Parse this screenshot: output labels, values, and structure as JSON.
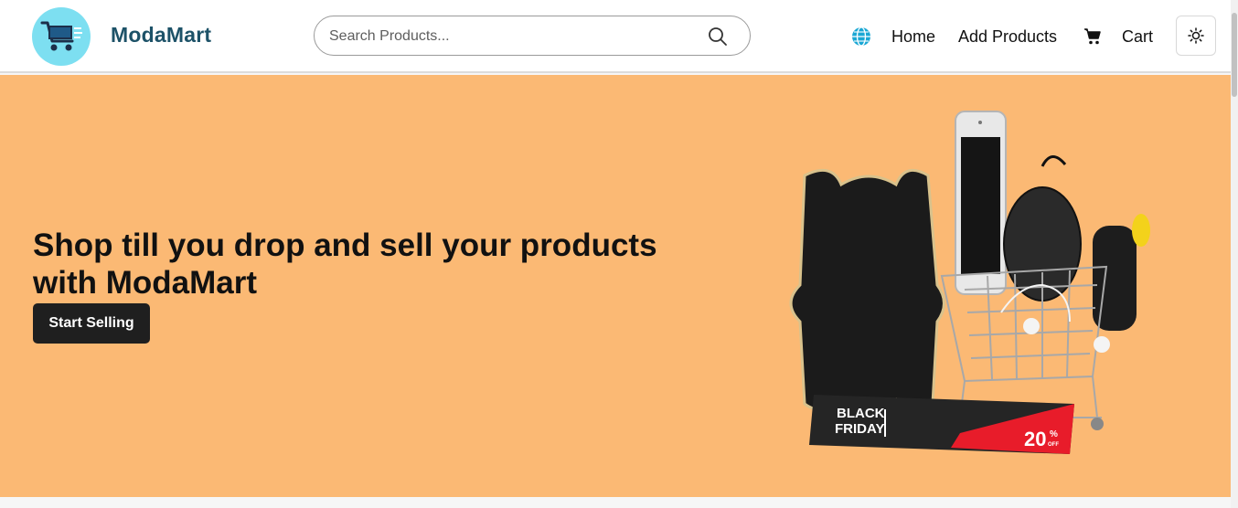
{
  "brand": {
    "name": "ModaMart",
    "logo_icon": "shopping-cart-logo-icon"
  },
  "search": {
    "placeholder": "Search Products...",
    "value": "",
    "icon": "search-icon"
  },
  "nav": {
    "language_icon": "globe-icon",
    "home_label": "Home",
    "add_products_label": "Add Products",
    "cart_icon": "cart-icon",
    "cart_label": "Cart",
    "theme_toggle_icon": "sun-icon"
  },
  "hero": {
    "headline": "Shop till you drop and sell your products with ModaMart",
    "cta_label": "Start Selling",
    "image_text": {
      "line1": "BLACK",
      "line2": "FRIDAY",
      "discount": "20",
      "percent": "%",
      "off": "OFF"
    },
    "background_color": "#fbb974"
  },
  "colors": {
    "brand": "#1d5268",
    "logo_bg": "#7ddff1",
    "globe": "#1aa7d4",
    "cta_bg": "#1f1f1f"
  }
}
